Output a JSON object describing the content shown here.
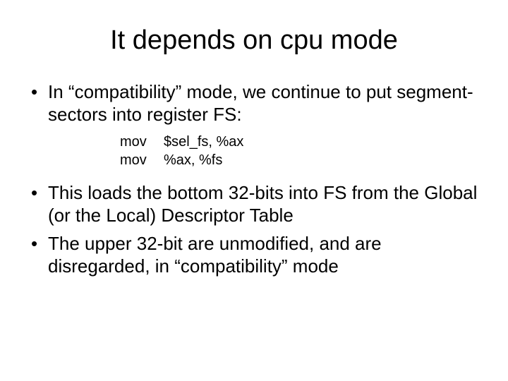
{
  "title": "It depends on cpu mode",
  "bullets": {
    "b1": "In “compatibility” mode, we continue to put segment-sectors into register FS:",
    "b2": "This loads the bottom 32-bits into FS from the Global (or the Local) Descriptor Table",
    "b3": "The upper 32-bit are unmodified, and are disregarded, in “compatibility” mode"
  },
  "code": {
    "l1_mn": "mov",
    "l1_ops": "$sel_fs, %ax",
    "l2_mn": "mov",
    "l2_ops": "%ax, %fs"
  }
}
